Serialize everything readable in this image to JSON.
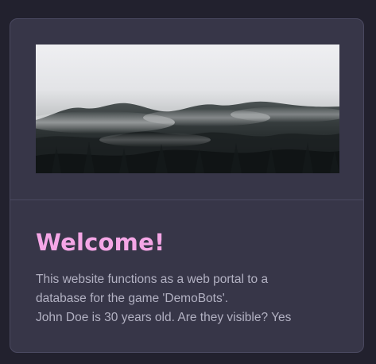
{
  "card": {
    "image_alt": "forest-fog-photo",
    "title": "Welcome!",
    "description_lines": [
      "This website functions as a web portal to a",
      "database for the game 'DemoBots'.",
      "John Doe is 30 years old. Are they visible? Yes"
    ]
  },
  "colors": {
    "page_background": "#22212e",
    "card_background": "#373648",
    "title": "#f4a6e6",
    "body_text": "#b2b1c2"
  }
}
